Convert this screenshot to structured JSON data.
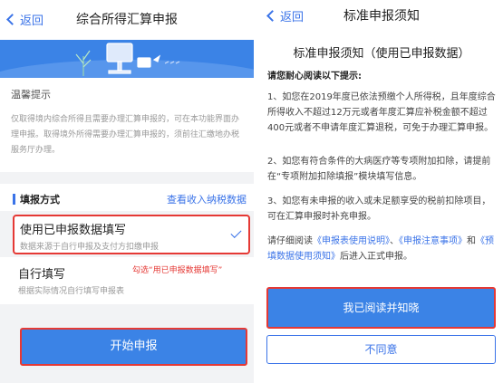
{
  "left": {
    "back_label": "返回",
    "title": "综合所得汇算申报",
    "tips": {
      "title": "温馨提示",
      "text": "仅取得境内综合所得且需要办理汇算申报的，可在本功能界面办理申报。取得境外所得需要办理汇算申报的，须前往汇缴地办税服务厅办理。"
    },
    "method": {
      "title": "填报方式",
      "link": "查看收入纳税数据"
    },
    "option1": {
      "title": "使用已申报数据填写",
      "desc": "数据来源于自行申报及支付方扣缴申报"
    },
    "option2": {
      "title": "自行填写",
      "desc": "根据实际情况自行填写申报表"
    },
    "note": "勾选“用已申报数据填写”",
    "start_button": "开始申报"
  },
  "right": {
    "back_label": "返回",
    "title": "标准申报须知",
    "heading": "标准申报须知（使用已申报数据）",
    "prompt": "请您耐心阅读以下提示:",
    "para1": "1、如您在2019年度已依法预缴个人所得税，且年度综合所得收入不超过12万元或者年度汇算应补税金额不超过400元或者不申请年度汇算退税，可免于办理汇算申报。",
    "para2": "2、如您有符合条件的大病医疗等专项附加扣除，请提前在“专项附加扣除填报”模块填写信息。",
    "para3": "3、如您有未申报的收入或未足额享受的税前扣除项目，可在汇算申报时补充申报。",
    "para4": {
      "pre": "请仔细阅读",
      "link1": "《申报表使用说明》",
      "sep1": "、",
      "link2": "《申报注意事项》",
      "sep2": "和",
      "link3": "《预填数据使用须知》",
      "post": "后进入正式申报。"
    },
    "agree_button": "我已阅读并知晓",
    "disagree_button": "不同意"
  }
}
